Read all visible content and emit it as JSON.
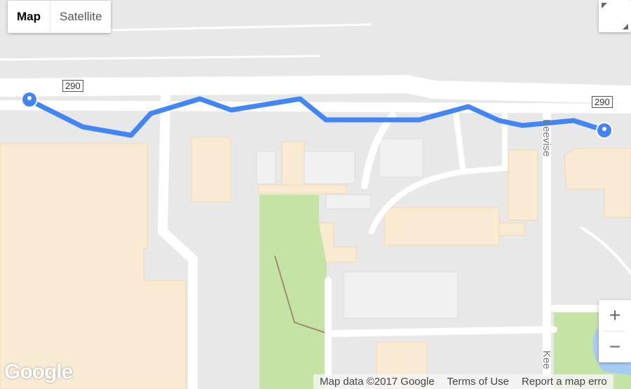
{
  "map_type": {
    "options": [
      "Map",
      "Satellite"
    ],
    "selected": "Map"
  },
  "route_shields": [
    "290",
    "290"
  ],
  "street_labels": [
    "Keevise",
    "Kee"
  ],
  "zoom": {
    "in_label": "+",
    "out_label": "−"
  },
  "footer": {
    "map_data": "Map data ©2017 Google",
    "terms": "Terms of Use",
    "report": "Report a map erro"
  },
  "logo": "Google",
  "colors": {
    "route": "#4285f4",
    "building": "#f9ebd3",
    "park": "#c5e3a4",
    "road": "#ffffff",
    "water": "#a6cbf5"
  },
  "markers": [
    "start-marker",
    "end-marker"
  ]
}
